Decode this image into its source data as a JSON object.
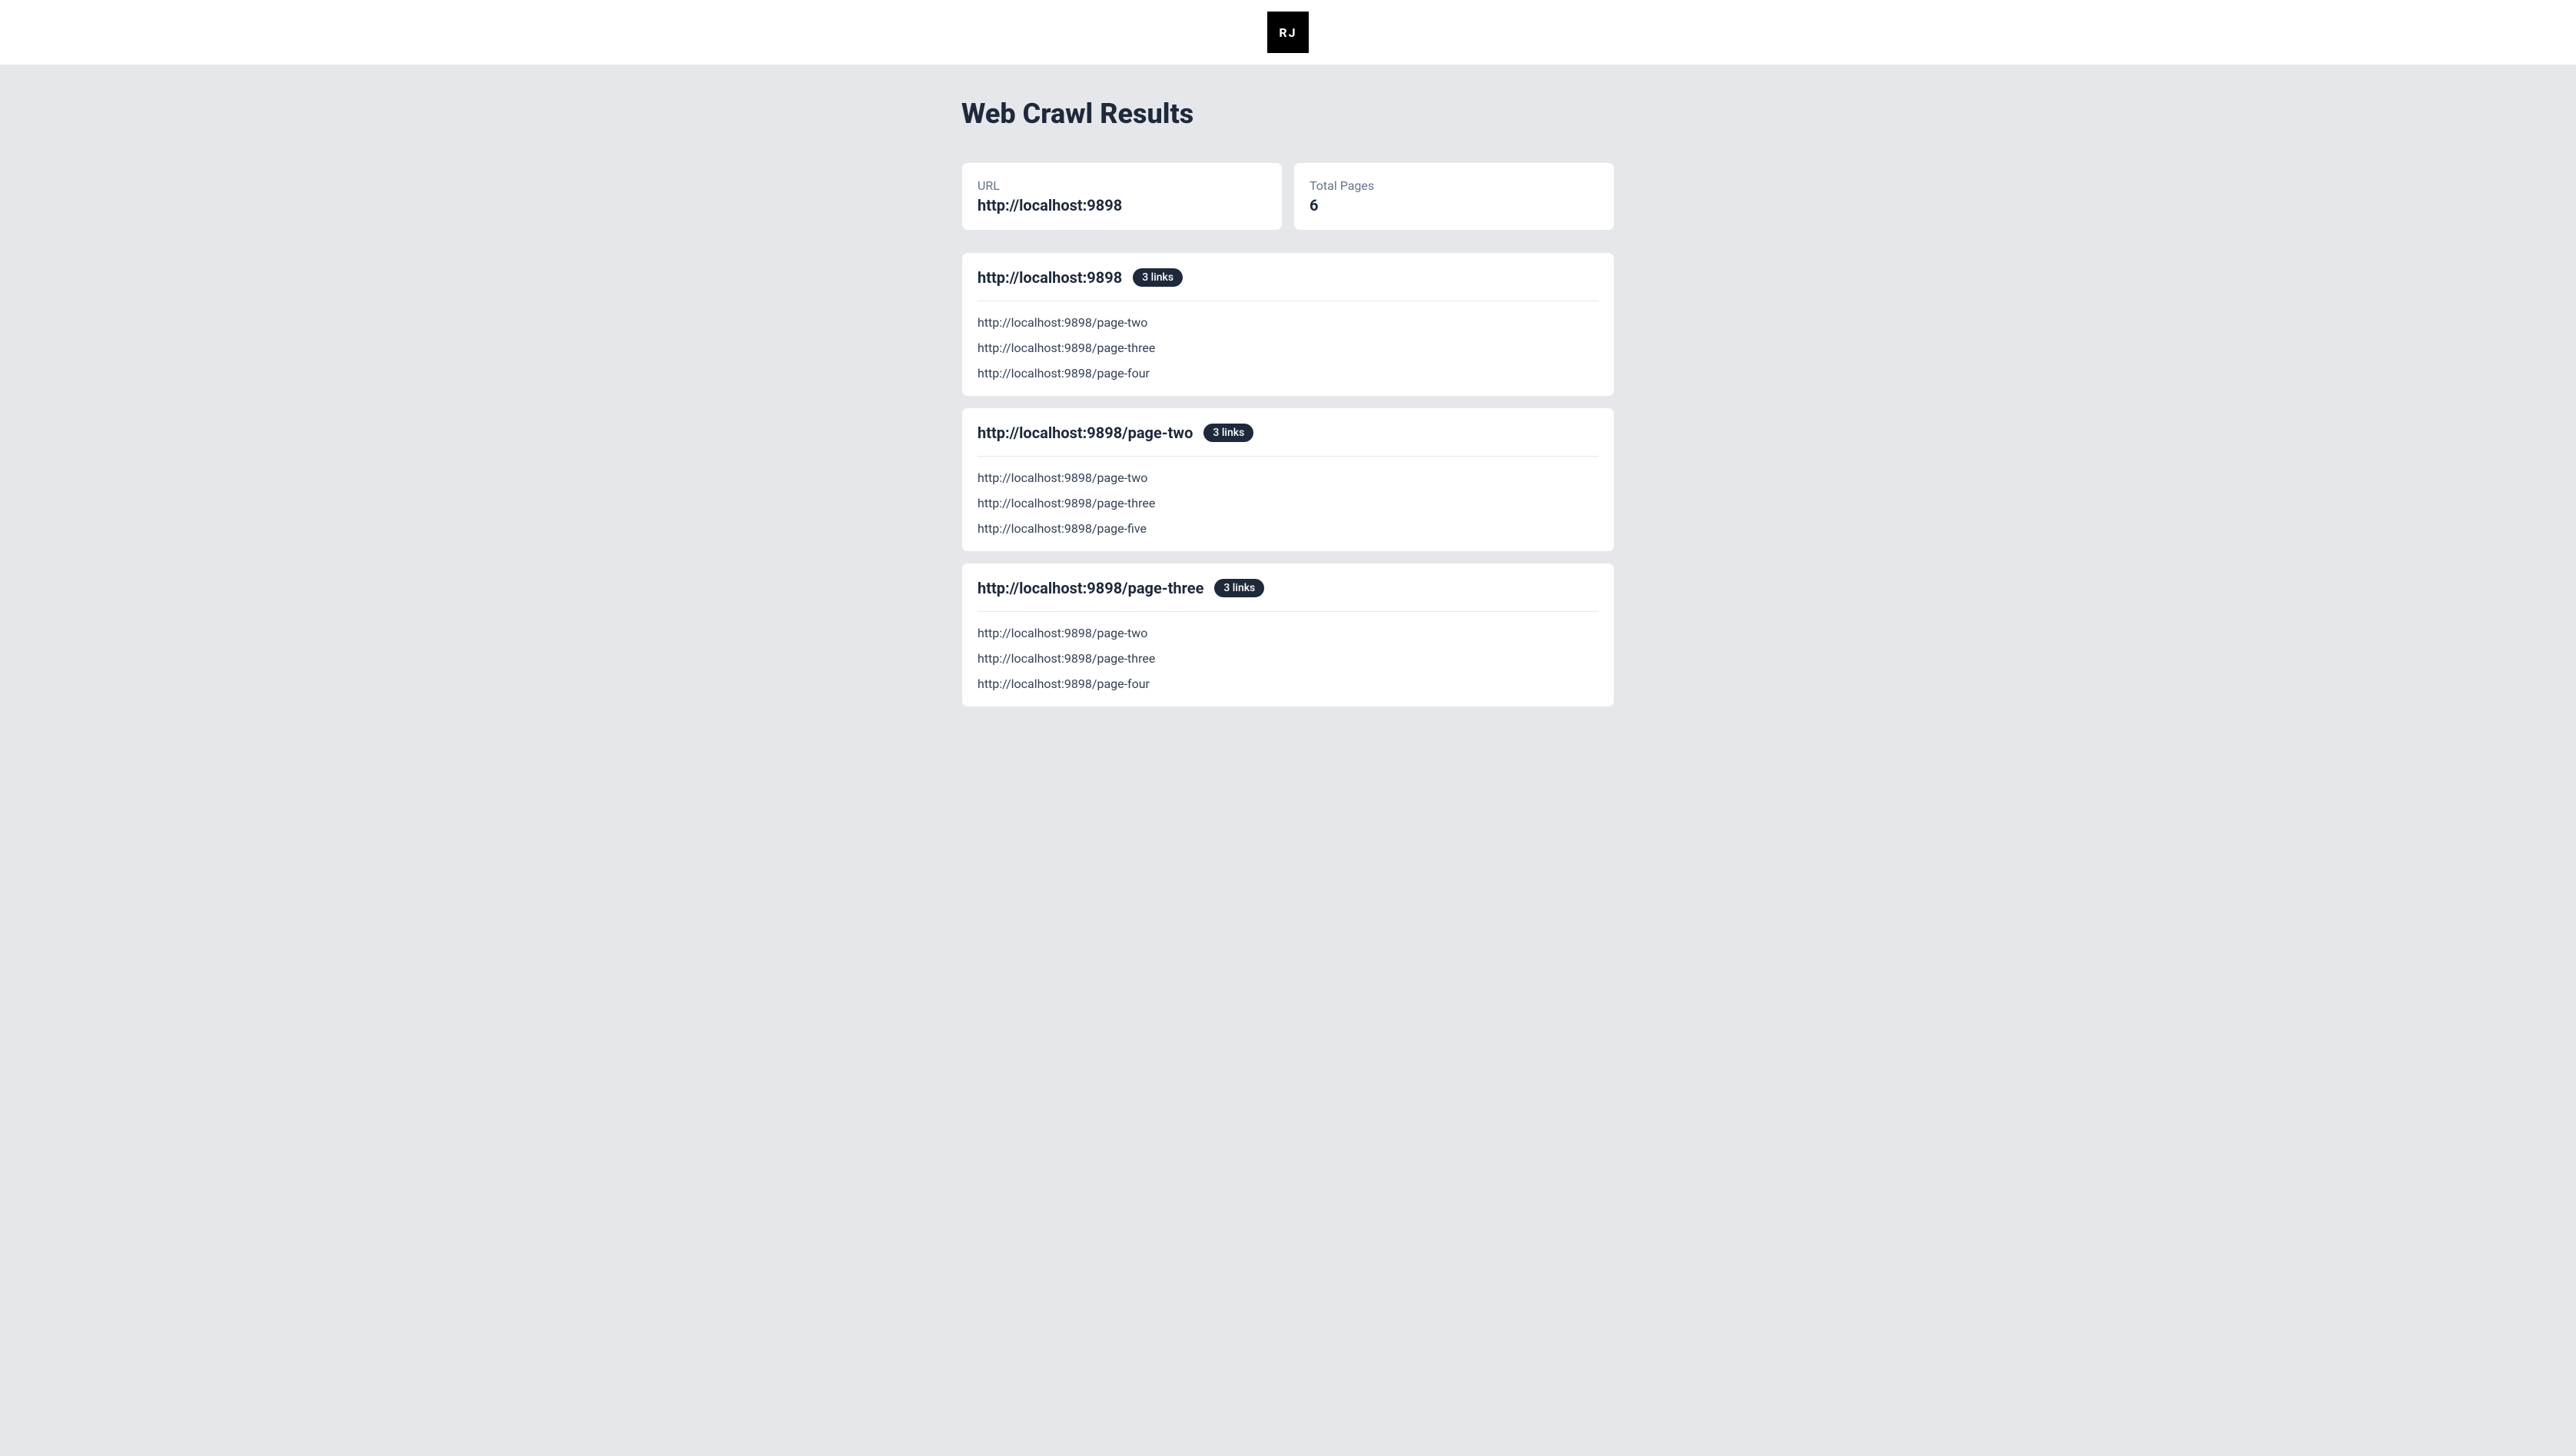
{
  "header": {
    "logo_text": "RJ"
  },
  "page_title": "Web Crawl Results",
  "summary": {
    "url_label": "URL",
    "url_value": "http://localhost:9898",
    "total_pages_label": "Total Pages",
    "total_pages_value": "6"
  },
  "results": [
    {
      "url": "http://localhost:9898",
      "link_count": "3 links",
      "links": [
        "http://localhost:9898/page-two",
        "http://localhost:9898/page-three",
        "http://localhost:9898/page-four"
      ]
    },
    {
      "url": "http://localhost:9898/page-two",
      "link_count": "3 links",
      "links": [
        "http://localhost:9898/page-two",
        "http://localhost:9898/page-three",
        "http://localhost:9898/page-five"
      ]
    },
    {
      "url": "http://localhost:9898/page-three",
      "link_count": "3 links",
      "links": [
        "http://localhost:9898/page-two",
        "http://localhost:9898/page-three",
        "http://localhost:9898/page-four"
      ]
    }
  ]
}
